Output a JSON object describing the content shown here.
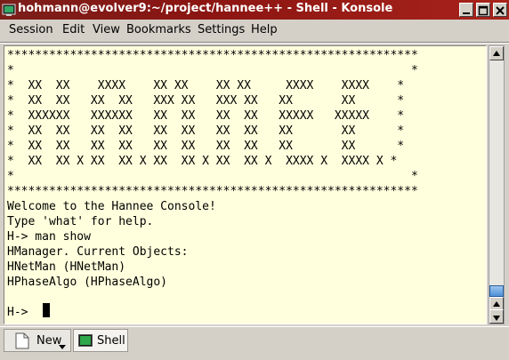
{
  "window": {
    "title": "hohmann@evolver9:~/project/hannee++ - Shell - Konsole"
  },
  "menu": [
    "Session",
    "Edit",
    "View",
    "Bookmarks",
    "Settings",
    "Help"
  ],
  "terminal": {
    "lines": [
      "***********************************************************",
      "*                                                         *",
      "*  XX  XX    XXXX    XX XX    XX XX     XXXX    XXXX    *",
      "*  XX  XX   XX  XX   XXX XX   XXX XX   XX       XX      *",
      "*  XXXXXX   XXXXXX   XX  XX   XX  XX   XXXXX   XXXXX    *",
      "*  XX  XX   XX  XX   XX  XX   XX  XX   XX       XX      *",
      "*  XX  XX   XX  XX   XX  XX   XX  XX   XX       XX      *",
      "*  XX  XX X XX  XX X XX  XX X XX  XX X  XXXX X  XXXX X *",
      "*                                                         *",
      "***********************************************************",
      "Welcome to the Hannee Console!",
      "Type 'what' for help.",
      "H-> man show",
      "HManager. Current Objects:",
      "HNetMan (HNetMan)",
      "HPhaseAlgo (HPhaseAlgo)",
      "",
      "H-> "
    ]
  },
  "tabs": {
    "new_label": "New",
    "shell_label": "Shell"
  },
  "colors": {
    "titlebar": "#8b1512",
    "terminal_bg": "#ffffdd",
    "scroll_thumb": "#4f8fd6"
  }
}
